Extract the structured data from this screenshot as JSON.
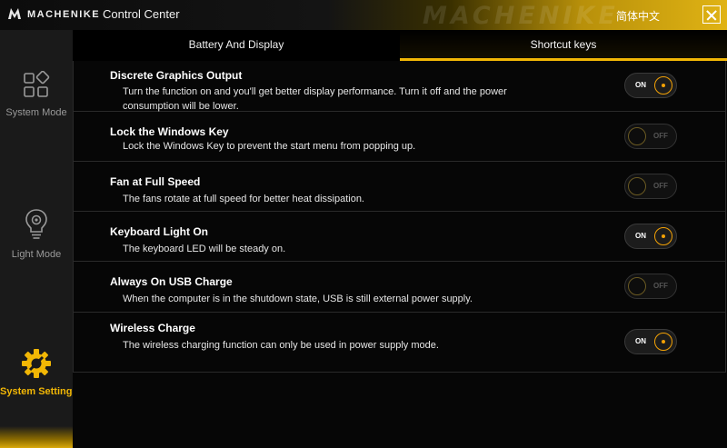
{
  "window": {
    "brand": "MACHENIKE",
    "title": "Control Center",
    "watermark": "MACHENIKE",
    "language_button": "简体中文"
  },
  "sidebar": {
    "items": [
      {
        "label": "System Mode",
        "icon": "system-mode-icon",
        "active": false
      },
      {
        "label": "Light Mode",
        "icon": "light-bulb-icon",
        "active": false
      },
      {
        "label": "System Settings",
        "icon": "gear-icon",
        "active": true
      }
    ]
  },
  "tabs": [
    {
      "label": "Battery And Display",
      "active": false
    },
    {
      "label": "Shortcut  keys",
      "active": true
    }
  ],
  "settings": [
    {
      "title": "Discrete Graphics Output",
      "description": "Turn the function on and you'll get better display performance. Turn it off and the power consumption will be lower.",
      "state": "ON"
    },
    {
      "title": "Lock the Windows Key",
      "description": "Lock the Windows Key to prevent the start menu from popping up.",
      "state": "OFF"
    },
    {
      "title": "Fan at Full Speed",
      "description": "The fans rotate at full speed for better heat dissipation.",
      "state": "OFF"
    },
    {
      "title": "Keyboard Light On",
      "description": "The keyboard LED will be steady on.",
      "state": "ON"
    },
    {
      "title": "Always On USB Charge",
      "description": "When the computer is in the shutdown state, USB is still external power supply.",
      "state": "OFF"
    },
    {
      "title": "Wireless Charge",
      "description": "The wireless charging function can only be used in power supply mode.",
      "state": "ON"
    }
  ],
  "colors": {
    "accent": "#f2b705",
    "toggle_on_ring": "#f2a105",
    "background": "#000000",
    "sidebar": "#1a1a1a"
  }
}
